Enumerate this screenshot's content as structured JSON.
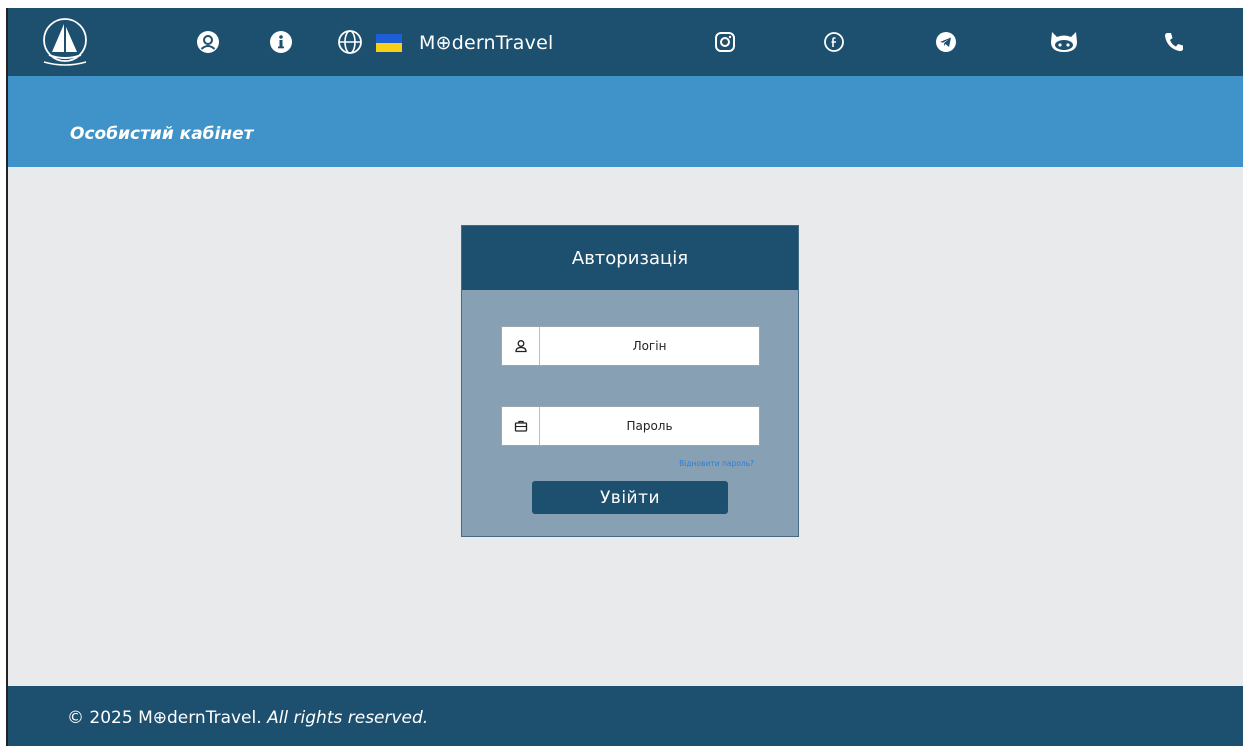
{
  "nav": {
    "brand": "M⊕dernTravel",
    "icons": [
      "sailboat-logo-icon",
      "user-circle-icon",
      "info-icon",
      "globe-icon",
      "ukraine-flag-icon",
      "instagram-icon",
      "facebook-icon",
      "telegram-icon",
      "github-icon",
      "phone-icon"
    ],
    "flag_colors": {
      "top": "#1f5fd6",
      "bottom": "#f8d018"
    }
  },
  "banner": {
    "title": "Особистий кабінет"
  },
  "auth": {
    "title": "Авторизація",
    "login_placeholder": "Логін",
    "password_placeholder": "Пароль",
    "forgot_link": "Відновити пароль?",
    "submit_label": "Увійти"
  },
  "footer": {
    "copyright": "© 2025",
    "brand": "M⊕dernTravel.",
    "rights": "All rights reserved."
  },
  "colors": {
    "nav_bg": "#1d4f6e",
    "banner_bg": "#3f93c8",
    "card_bg": "#87a0b4",
    "page_bg": "#e9eaec",
    "link": "#2f7fd8"
  }
}
